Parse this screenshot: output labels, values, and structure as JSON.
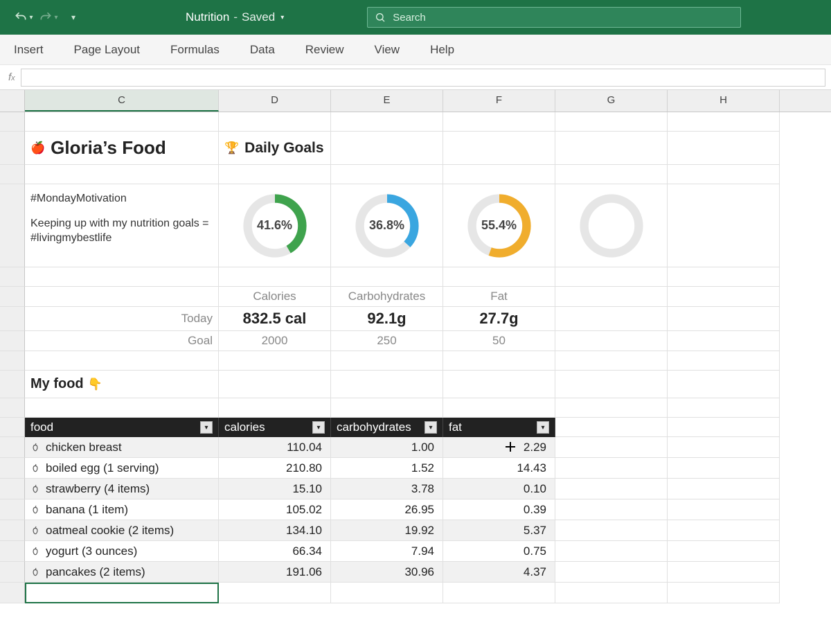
{
  "titlebar": {
    "doc_name": "Nutrition",
    "save_state": "Saved",
    "search_placeholder": "Search"
  },
  "ribbon": {
    "tabs": [
      "Insert",
      "Page Layout",
      "Formulas",
      "Data",
      "Review",
      "View",
      "Help"
    ]
  },
  "columns": [
    "C",
    "D",
    "E",
    "F",
    "G",
    "H"
  ],
  "sheet": {
    "title": "Gloria’s Food",
    "goals_title": "Daily Goals",
    "note_line1": "#MondayMotivation",
    "note_line2": "Keeping up with my nutrition goals = #livingmybestlife",
    "row_today": "Today",
    "row_goal": "Goal",
    "section_myfood": "My food"
  },
  "goals": {
    "calories": {
      "label": "Calories",
      "pct": "41.6%",
      "pct_num": 41.6,
      "today": "832.5 cal",
      "goal": "2000",
      "color": "#3fa34d"
    },
    "carbs": {
      "label": "Carbohydrates",
      "pct": "36.8%",
      "pct_num": 36.8,
      "today": "92.1g",
      "goal": "250",
      "color": "#3aa6e0"
    },
    "fat": {
      "label": "Fat",
      "pct": "55.4%",
      "pct_num": 55.4,
      "today": "27.7g",
      "goal": "50",
      "color": "#f0ad2d"
    },
    "blank": {
      "label": "",
      "pct": "",
      "pct_num": 0,
      "today": "",
      "goal": "",
      "color": "#e6e6e6"
    }
  },
  "table": {
    "headers": {
      "food": "food",
      "calories": "calories",
      "carbs": "carbohydrates",
      "fat": "fat"
    },
    "rows": [
      {
        "food": "chicken breast",
        "calories": "110.04",
        "carbs": "1.00",
        "fat": "2.29"
      },
      {
        "food": "boiled egg (1 serving)",
        "calories": "210.80",
        "carbs": "1.52",
        "fat": "14.43"
      },
      {
        "food": "strawberry (4 items)",
        "calories": "15.10",
        "carbs": "3.78",
        "fat": "0.10"
      },
      {
        "food": "banana (1 item)",
        "calories": "105.02",
        "carbs": "26.95",
        "fat": "0.39"
      },
      {
        "food": "oatmeal cookie (2 items)",
        "calories": "134.10",
        "carbs": "19.92",
        "fat": "5.37"
      },
      {
        "food": "yogurt (3 ounces)",
        "calories": "66.34",
        "carbs": "7.94",
        "fat": "0.75"
      },
      {
        "food": "pancakes (2 items)",
        "calories": "191.06",
        "carbs": "30.96",
        "fat": "4.37"
      }
    ]
  },
  "chart_data": [
    {
      "type": "pie",
      "title": "Calories",
      "values": [
        41.6,
        58.4
      ],
      "categories": [
        "progress",
        "remaining"
      ],
      "color": "#3fa34d"
    },
    {
      "type": "pie",
      "title": "Carbohydrates",
      "values": [
        36.8,
        63.2
      ],
      "categories": [
        "progress",
        "remaining"
      ],
      "color": "#3aa6e0"
    },
    {
      "type": "pie",
      "title": "Fat",
      "values": [
        55.4,
        44.6
      ],
      "categories": [
        "progress",
        "remaining"
      ],
      "color": "#f0ad2d"
    }
  ]
}
